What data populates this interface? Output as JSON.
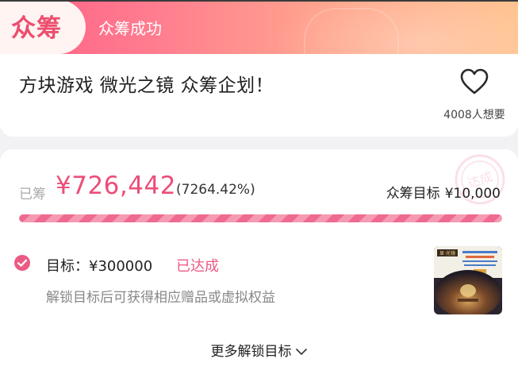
{
  "header": {
    "badge_text": "众筹",
    "status_text": "众筹成功"
  },
  "project": {
    "title": "方块游戏 微光之镜 众筹企划！",
    "want_count_text": "4008人想要"
  },
  "funding": {
    "raised_label": "已筹",
    "raised_amount": "¥726,442",
    "raised_percent": "(7264.42%)",
    "goal_label": "众筹目标",
    "goal_amount": "¥10,000",
    "progress_fraction": 1.0,
    "stamp_text": "达成"
  },
  "unlock": {
    "target_text": "目标：¥300000",
    "target_status": "已达成",
    "description": "解锁目标后可获得相应赠品或虚拟权益",
    "thumb_label": "显·光镜",
    "more_label": "更多解锁目标"
  },
  "colors": {
    "accent": "#ec4e79",
    "banner_start": "#ff5e86",
    "banner_end": "#ffc28e"
  },
  "icons": [
    "heart-icon",
    "check-circle-icon",
    "chevron-down-icon",
    "achieved-stamp-icon"
  ]
}
